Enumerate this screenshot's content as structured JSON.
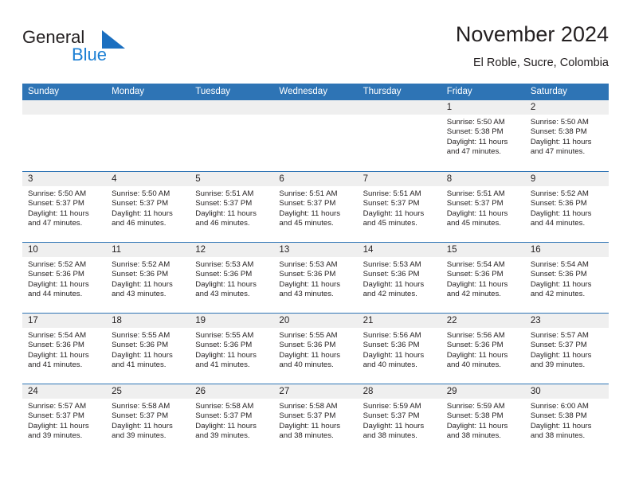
{
  "brand": {
    "name_part1": "General",
    "name_part2": "Blue",
    "accent_color": "#1b7fd4",
    "mark_color": "#1b6fc0"
  },
  "header": {
    "title": "November 2024",
    "subtitle": "El Roble, Sucre, Colombia"
  },
  "theme": {
    "header_blue": "#2e74b5",
    "daynum_strip": "#efefef",
    "text": "#231f20"
  },
  "weekday_headers": [
    "Sunday",
    "Monday",
    "Tuesday",
    "Wednesday",
    "Thursday",
    "Friday",
    "Saturday"
  ],
  "labels": {
    "sunrise_prefix": "Sunrise:",
    "sunset_prefix": "Sunset:",
    "daylight_prefix": "Daylight:"
  },
  "weeks": [
    [
      {
        "day": "",
        "sunrise": "",
        "sunset": "",
        "daylight_line1": "",
        "daylight_line2": ""
      },
      {
        "day": "",
        "sunrise": "",
        "sunset": "",
        "daylight_line1": "",
        "daylight_line2": ""
      },
      {
        "day": "",
        "sunrise": "",
        "sunset": "",
        "daylight_line1": "",
        "daylight_line2": ""
      },
      {
        "day": "",
        "sunrise": "",
        "sunset": "",
        "daylight_line1": "",
        "daylight_line2": ""
      },
      {
        "day": "",
        "sunrise": "",
        "sunset": "",
        "daylight_line1": "",
        "daylight_line2": ""
      },
      {
        "day": "1",
        "sunrise": "Sunrise: 5:50 AM",
        "sunset": "Sunset: 5:38 PM",
        "daylight_line1": "Daylight: 11 hours",
        "daylight_line2": "and 47 minutes."
      },
      {
        "day": "2",
        "sunrise": "Sunrise: 5:50 AM",
        "sunset": "Sunset: 5:38 PM",
        "daylight_line1": "Daylight: 11 hours",
        "daylight_line2": "and 47 minutes."
      }
    ],
    [
      {
        "day": "3",
        "sunrise": "Sunrise: 5:50 AM",
        "sunset": "Sunset: 5:37 PM",
        "daylight_line1": "Daylight: 11 hours",
        "daylight_line2": "and 47 minutes."
      },
      {
        "day": "4",
        "sunrise": "Sunrise: 5:50 AM",
        "sunset": "Sunset: 5:37 PM",
        "daylight_line1": "Daylight: 11 hours",
        "daylight_line2": "and 46 minutes."
      },
      {
        "day": "5",
        "sunrise": "Sunrise: 5:51 AM",
        "sunset": "Sunset: 5:37 PM",
        "daylight_line1": "Daylight: 11 hours",
        "daylight_line2": "and 46 minutes."
      },
      {
        "day": "6",
        "sunrise": "Sunrise: 5:51 AM",
        "sunset": "Sunset: 5:37 PM",
        "daylight_line1": "Daylight: 11 hours",
        "daylight_line2": "and 45 minutes."
      },
      {
        "day": "7",
        "sunrise": "Sunrise: 5:51 AM",
        "sunset": "Sunset: 5:37 PM",
        "daylight_line1": "Daylight: 11 hours",
        "daylight_line2": "and 45 minutes."
      },
      {
        "day": "8",
        "sunrise": "Sunrise: 5:51 AM",
        "sunset": "Sunset: 5:37 PM",
        "daylight_line1": "Daylight: 11 hours",
        "daylight_line2": "and 45 minutes."
      },
      {
        "day": "9",
        "sunrise": "Sunrise: 5:52 AM",
        "sunset": "Sunset: 5:36 PM",
        "daylight_line1": "Daylight: 11 hours",
        "daylight_line2": "and 44 minutes."
      }
    ],
    [
      {
        "day": "10",
        "sunrise": "Sunrise: 5:52 AM",
        "sunset": "Sunset: 5:36 PM",
        "daylight_line1": "Daylight: 11 hours",
        "daylight_line2": "and 44 minutes."
      },
      {
        "day": "11",
        "sunrise": "Sunrise: 5:52 AM",
        "sunset": "Sunset: 5:36 PM",
        "daylight_line1": "Daylight: 11 hours",
        "daylight_line2": "and 43 minutes."
      },
      {
        "day": "12",
        "sunrise": "Sunrise: 5:53 AM",
        "sunset": "Sunset: 5:36 PM",
        "daylight_line1": "Daylight: 11 hours",
        "daylight_line2": "and 43 minutes."
      },
      {
        "day": "13",
        "sunrise": "Sunrise: 5:53 AM",
        "sunset": "Sunset: 5:36 PM",
        "daylight_line1": "Daylight: 11 hours",
        "daylight_line2": "and 43 minutes."
      },
      {
        "day": "14",
        "sunrise": "Sunrise: 5:53 AM",
        "sunset": "Sunset: 5:36 PM",
        "daylight_line1": "Daylight: 11 hours",
        "daylight_line2": "and 42 minutes."
      },
      {
        "day": "15",
        "sunrise": "Sunrise: 5:54 AM",
        "sunset": "Sunset: 5:36 PM",
        "daylight_line1": "Daylight: 11 hours",
        "daylight_line2": "and 42 minutes."
      },
      {
        "day": "16",
        "sunrise": "Sunrise: 5:54 AM",
        "sunset": "Sunset: 5:36 PM",
        "daylight_line1": "Daylight: 11 hours",
        "daylight_line2": "and 42 minutes."
      }
    ],
    [
      {
        "day": "17",
        "sunrise": "Sunrise: 5:54 AM",
        "sunset": "Sunset: 5:36 PM",
        "daylight_line1": "Daylight: 11 hours",
        "daylight_line2": "and 41 minutes."
      },
      {
        "day": "18",
        "sunrise": "Sunrise: 5:55 AM",
        "sunset": "Sunset: 5:36 PM",
        "daylight_line1": "Daylight: 11 hours",
        "daylight_line2": "and 41 minutes."
      },
      {
        "day": "19",
        "sunrise": "Sunrise: 5:55 AM",
        "sunset": "Sunset: 5:36 PM",
        "daylight_line1": "Daylight: 11 hours",
        "daylight_line2": "and 41 minutes."
      },
      {
        "day": "20",
        "sunrise": "Sunrise: 5:55 AM",
        "sunset": "Sunset: 5:36 PM",
        "daylight_line1": "Daylight: 11 hours",
        "daylight_line2": "and 40 minutes."
      },
      {
        "day": "21",
        "sunrise": "Sunrise: 5:56 AM",
        "sunset": "Sunset: 5:36 PM",
        "daylight_line1": "Daylight: 11 hours",
        "daylight_line2": "and 40 minutes."
      },
      {
        "day": "22",
        "sunrise": "Sunrise: 5:56 AM",
        "sunset": "Sunset: 5:36 PM",
        "daylight_line1": "Daylight: 11 hours",
        "daylight_line2": "and 40 minutes."
      },
      {
        "day": "23",
        "sunrise": "Sunrise: 5:57 AM",
        "sunset": "Sunset: 5:37 PM",
        "daylight_line1": "Daylight: 11 hours",
        "daylight_line2": "and 39 minutes."
      }
    ],
    [
      {
        "day": "24",
        "sunrise": "Sunrise: 5:57 AM",
        "sunset": "Sunset: 5:37 PM",
        "daylight_line1": "Daylight: 11 hours",
        "daylight_line2": "and 39 minutes."
      },
      {
        "day": "25",
        "sunrise": "Sunrise: 5:58 AM",
        "sunset": "Sunset: 5:37 PM",
        "daylight_line1": "Daylight: 11 hours",
        "daylight_line2": "and 39 minutes."
      },
      {
        "day": "26",
        "sunrise": "Sunrise: 5:58 AM",
        "sunset": "Sunset: 5:37 PM",
        "daylight_line1": "Daylight: 11 hours",
        "daylight_line2": "and 39 minutes."
      },
      {
        "day": "27",
        "sunrise": "Sunrise: 5:58 AM",
        "sunset": "Sunset: 5:37 PM",
        "daylight_line1": "Daylight: 11 hours",
        "daylight_line2": "and 38 minutes."
      },
      {
        "day": "28",
        "sunrise": "Sunrise: 5:59 AM",
        "sunset": "Sunset: 5:37 PM",
        "daylight_line1": "Daylight: 11 hours",
        "daylight_line2": "and 38 minutes."
      },
      {
        "day": "29",
        "sunrise": "Sunrise: 5:59 AM",
        "sunset": "Sunset: 5:38 PM",
        "daylight_line1": "Daylight: 11 hours",
        "daylight_line2": "and 38 minutes."
      },
      {
        "day": "30",
        "sunrise": "Sunrise: 6:00 AM",
        "sunset": "Sunset: 5:38 PM",
        "daylight_line1": "Daylight: 11 hours",
        "daylight_line2": "and 38 minutes."
      }
    ]
  ]
}
